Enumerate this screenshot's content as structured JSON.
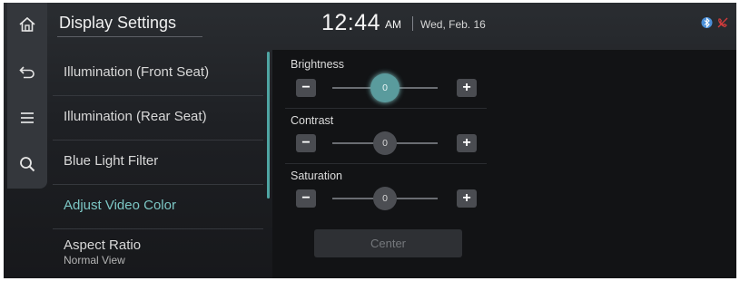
{
  "header": {
    "title": "Display Settings",
    "time": "12:44",
    "ampm": "AM",
    "date": "Wed, Feb. 16",
    "status_icons": [
      "bluetooth-icon",
      "phone-muted-icon"
    ]
  },
  "rail": {
    "items": [
      "home-icon",
      "back-icon",
      "menu-icon",
      "search-icon"
    ]
  },
  "menu": {
    "items": [
      {
        "label": "Illumination (Front Seat)"
      },
      {
        "label": "Illumination (Rear Seat)"
      },
      {
        "label": "Blue Light Filter"
      },
      {
        "label": "Adjust Video Color",
        "active": true
      },
      {
        "label": "Aspect Ratio",
        "sub": "Normal View"
      }
    ]
  },
  "adjust": {
    "controls": [
      {
        "label": "Brightness",
        "value": "0",
        "selected": true
      },
      {
        "label": "Contrast",
        "value": "0",
        "selected": false
      },
      {
        "label": "Saturation",
        "value": "0",
        "selected": false
      }
    ],
    "minus_symbol": "−",
    "plus_symbol": "+",
    "center_label": "Center"
  },
  "colors": {
    "accent": "#7cc7c5",
    "knob_selected": "#5a9b9d",
    "bluetooth": "#4a8fd8",
    "phone_muted": "#d23b3b"
  }
}
